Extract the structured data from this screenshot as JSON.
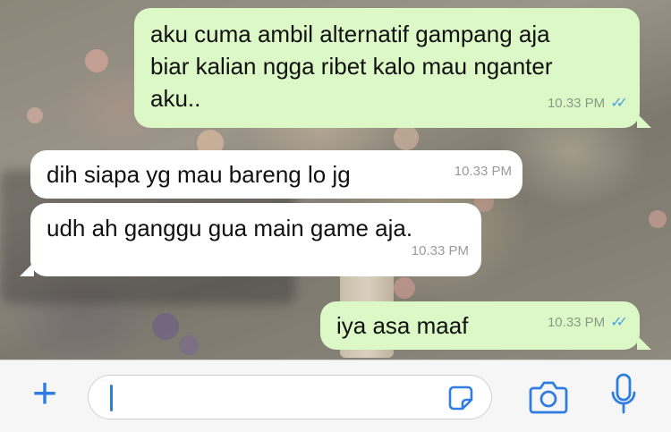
{
  "messages": [
    {
      "direction": "out",
      "text": "aku cuma ambil alternatif gampang aja\nbiar kalian ngga ribet kalo mau nganter\naku..",
      "time": "10.33 PM",
      "status": "read"
    },
    {
      "direction": "in",
      "text": "dih siapa yg mau bareng lo jg",
      "time": "10.33 PM"
    },
    {
      "direction": "in",
      "text": "udh ah ganggu gua main game aja.",
      "time": "10.33 PM"
    },
    {
      "direction": "out",
      "text": "iya asa maaf",
      "time": "10.33 PM",
      "status": "read"
    }
  ],
  "ticks_glyph": "✓✓",
  "input": {
    "value": "",
    "placeholder": "",
    "plus_glyph": "+"
  },
  "icons": {
    "plus": "plus-icon",
    "sticker": "sticker-icon",
    "camera": "camera-icon",
    "mic": "microphone-icon"
  },
  "colors": {
    "outgoing_bubble": "#dcf8c6",
    "incoming_bubble": "#ffffff",
    "accent": "#2f7de0",
    "read_ticks": "#4fa3e0"
  }
}
